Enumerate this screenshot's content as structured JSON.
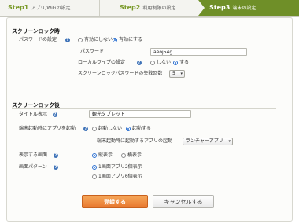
{
  "steps": [
    {
      "num": "Step1",
      "label": "アプリ/WiFiの設定"
    },
    {
      "num": "Step2",
      "label": "利用制限の設定"
    },
    {
      "num": "Step3",
      "label": "端末の設定"
    }
  ],
  "colors": {
    "step_active": "#6f8f28",
    "primary_button": "#e8772e",
    "help_icon": "#3f73b8"
  },
  "lock_section": {
    "title": "スクリーンロック時",
    "password_setting": {
      "label": "パスワードの設定",
      "options": [
        "有効にしない",
        "有効にする"
      ],
      "selected": "有効にする"
    },
    "password": {
      "label": "パスワード",
      "value": "aeoj54g"
    },
    "local_wipe": {
      "label": "ローカルワイプの設定",
      "options": [
        "しない",
        "する"
      ],
      "selected": "する"
    },
    "fail_count": {
      "label": "スクリーンロックパスワードの失敗回数",
      "value": "5"
    }
  },
  "after_section": {
    "title": "スクリーンロック後",
    "title_display": {
      "label": "タイトル表示",
      "value": "観光タブレット"
    },
    "launch_app": {
      "label": "端末起動時にアプリを起動",
      "options": [
        "起動しない",
        "起動する"
      ],
      "selected": "起動する",
      "sub_label": "端末起動時に起動するアプリの起動",
      "sub_value": "ランチャーアプリ"
    },
    "screen_orientation": {
      "label": "表示する画面",
      "options": [
        "縦表示",
        "横表示"
      ],
      "selected": "縦表示"
    },
    "screen_pattern": {
      "label": "画面パターン",
      "options": [
        "1画面アプリ2個表示",
        "1画面アプリ6個表示"
      ],
      "selected": "1画面アプリ2個表示"
    }
  },
  "buttons": {
    "register": "登録する",
    "cancel": "キャンセルする"
  }
}
